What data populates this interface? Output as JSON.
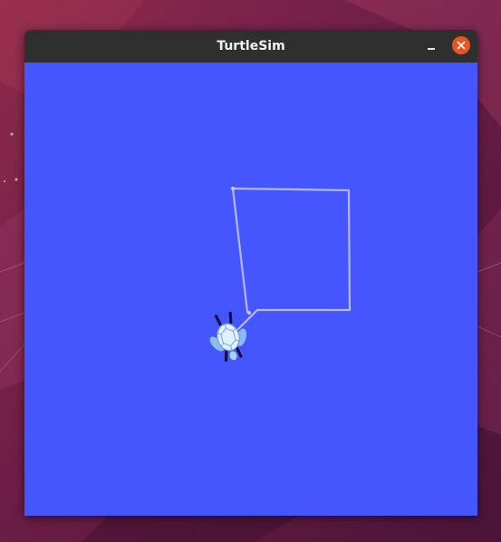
{
  "window": {
    "title": "TurtleSim"
  },
  "titlebar_buttons": {
    "minimize_icon": "minimize-icon",
    "close_icon": "close-icon",
    "close_color": "#e95420"
  },
  "canvas": {
    "background_color": "#4556ff",
    "pen_color": "#b3b8ff",
    "turtle_icon": "turtle-icon"
  },
  "desktop": {
    "wallpaper_color": "#5a1838"
  }
}
